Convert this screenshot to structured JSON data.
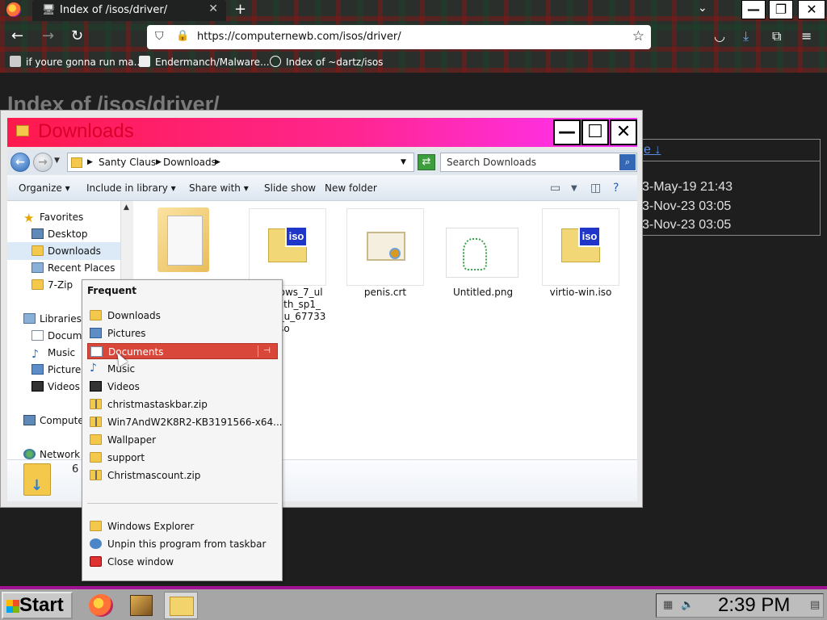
{
  "browser": {
    "tab_title": "Index of /isos/driver/",
    "new_tab_symbol": "+",
    "url": "https://computernewb.com/isos/driver/",
    "bookmarks": [
      {
        "label": "if youre gonna run ma..."
      },
      {
        "label": "Endermanch/Malware..."
      },
      {
        "label": "Index of ~dartz/isos"
      }
    ],
    "window_buttons": [
      "—",
      "❐",
      "✕"
    ]
  },
  "web_page": {
    "heading": "Index of /isos/driver/",
    "header_link_fragment": "e ↓",
    "dates": [
      "3-May-19 21:43",
      "3-Nov-23 03:05",
      "3-Nov-23 03:05"
    ]
  },
  "explorer": {
    "title": "Downloads",
    "window_buttons": [
      "—",
      "☐",
      "✕"
    ],
    "breadcrumb": [
      "Santy Claus",
      "Downloads"
    ],
    "search_placeholder": "Search Downloads",
    "commands": [
      "Organize",
      "Include in library",
      "Share with",
      "Slide show",
      "New folder"
    ],
    "nav": {
      "favorites": "Favorites",
      "desktop": "Desktop",
      "downloads": "Downloads",
      "recent": "Recent Places",
      "sevenzip": "7-Zip",
      "libraries": "Libraries",
      "documents": "Docume",
      "music": "Music",
      "pictures": "Pictures",
      "videos": "Videos",
      "computer": "Computer",
      "network": "Network"
    },
    "files": [
      {
        "name": "dows_7_ul\nwith_sp1_\nd_u_67733\n.iso",
        "icon": "iso"
      },
      {
        "name": "penis.crt",
        "icon": "certificate"
      },
      {
        "name": "Untitled.png",
        "icon": "image"
      },
      {
        "name": "virtio-win.iso",
        "icon": "iso"
      }
    ],
    "details_count": "6 i"
  },
  "jumplist": {
    "section": "Frequent",
    "items": [
      {
        "label": "Downloads",
        "icon": "folder"
      },
      {
        "label": "Pictures",
        "icon": "pictures"
      },
      {
        "label": "Documents",
        "icon": "documents",
        "highlighted": true
      },
      {
        "label": "Music",
        "icon": "music"
      },
      {
        "label": "Videos",
        "icon": "videos"
      },
      {
        "label": "christmastaskbar.zip",
        "icon": "zip"
      },
      {
        "label": "Win7AndW2K8R2-KB3191566-x64...",
        "icon": "zip"
      },
      {
        "label": "Wallpaper",
        "icon": "folder"
      },
      {
        "label": "support",
        "icon": "folder"
      },
      {
        "label": "Christmascount.zip",
        "icon": "zip"
      }
    ],
    "tasks": [
      {
        "label": "Windows Explorer",
        "icon": "folder"
      },
      {
        "label": "Unpin this program from taskbar",
        "icon": "unpin"
      },
      {
        "label": "Close window",
        "icon": "close"
      }
    ]
  },
  "taskbar": {
    "start_label": "Start",
    "clock": "2:39 PM"
  },
  "colors": {
    "explorer_title_gradient_start": "#ff1a4c",
    "explorer_title_gradient_end": "#ff33ff",
    "jumplist_highlight": "#d9473b",
    "taskbar_border": "#a0128f"
  }
}
